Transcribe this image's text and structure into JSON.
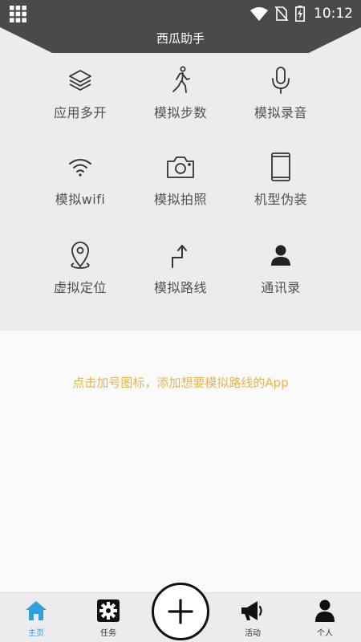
{
  "status_bar": {
    "time": "10:12"
  },
  "header": {
    "title": "西瓜助手"
  },
  "features": [
    {
      "label": "应用多开",
      "icon": "layers-icon"
    },
    {
      "label": "模拟步数",
      "icon": "walking-person-icon"
    },
    {
      "label": "模拟录音",
      "icon": "microphone-icon"
    },
    {
      "label": "模拟wifi",
      "icon": "wifi-icon"
    },
    {
      "label": "模拟拍照",
      "icon": "camera-icon"
    },
    {
      "label": "机型伪装",
      "icon": "phone-device-icon"
    },
    {
      "label": "虚拟定位",
      "icon": "location-pin-icon"
    },
    {
      "label": "模拟路线",
      "icon": "route-arrow-icon"
    },
    {
      "label": "通讯录",
      "icon": "contact-person-icon"
    }
  ],
  "content": {
    "hint": "点击加号图标，添加想要模拟路线的App"
  },
  "bottom_nav": {
    "items": [
      {
        "label": "主页",
        "icon": "home-icon",
        "active": true
      },
      {
        "label": "任务",
        "icon": "gear-icon",
        "active": false
      },
      {
        "label": "活动",
        "icon": "megaphone-icon",
        "active": false
      },
      {
        "label": "个人",
        "icon": "person-icon",
        "active": false
      }
    ],
    "add_icon": "plus-icon"
  },
  "colors": {
    "status_bar": "#4a4a4a",
    "hint_text": "#e6b44c",
    "active_tab": "#2f9fde"
  }
}
